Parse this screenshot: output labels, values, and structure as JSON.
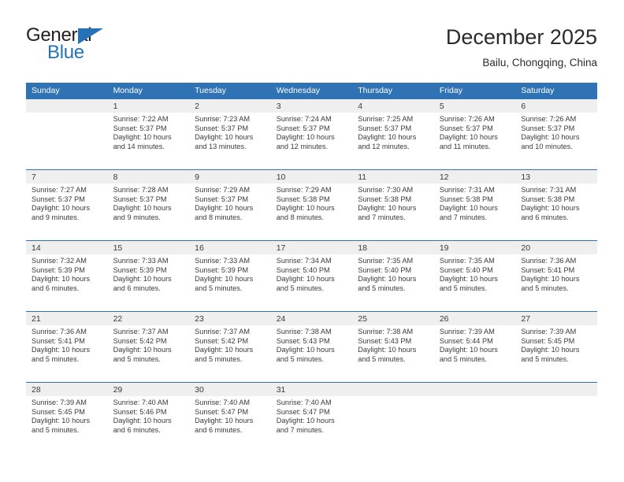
{
  "brand": {
    "name_top": "General",
    "name_bottom": "Blue",
    "triangle_color": "#2572b8",
    "text_color": "#231f20"
  },
  "header": {
    "title": "December 2025",
    "subtitle": "Bailu, Chongqing, China"
  },
  "theme": {
    "header_blue": "#3073b4",
    "daynum_bg": "#efefef",
    "text": "#3a3a3a"
  },
  "weekdays": [
    "Sunday",
    "Monday",
    "Tuesday",
    "Wednesday",
    "Thursday",
    "Friday",
    "Saturday"
  ],
  "weeks": [
    [
      {
        "day": "",
        "sunrise": "",
        "sunset": "",
        "daylight1": "",
        "daylight2": ""
      },
      {
        "day": "1",
        "sunrise": "Sunrise: 7:22 AM",
        "sunset": "Sunset: 5:37 PM",
        "daylight1": "Daylight: 10 hours",
        "daylight2": "and 14 minutes."
      },
      {
        "day": "2",
        "sunrise": "Sunrise: 7:23 AM",
        "sunset": "Sunset: 5:37 PM",
        "daylight1": "Daylight: 10 hours",
        "daylight2": "and 13 minutes."
      },
      {
        "day": "3",
        "sunrise": "Sunrise: 7:24 AM",
        "sunset": "Sunset: 5:37 PM",
        "daylight1": "Daylight: 10 hours",
        "daylight2": "and 12 minutes."
      },
      {
        "day": "4",
        "sunrise": "Sunrise: 7:25 AM",
        "sunset": "Sunset: 5:37 PM",
        "daylight1": "Daylight: 10 hours",
        "daylight2": "and 12 minutes."
      },
      {
        "day": "5",
        "sunrise": "Sunrise: 7:26 AM",
        "sunset": "Sunset: 5:37 PM",
        "daylight1": "Daylight: 10 hours",
        "daylight2": "and 11 minutes."
      },
      {
        "day": "6",
        "sunrise": "Sunrise: 7:26 AM",
        "sunset": "Sunset: 5:37 PM",
        "daylight1": "Daylight: 10 hours",
        "daylight2": "and 10 minutes."
      }
    ],
    [
      {
        "day": "7",
        "sunrise": "Sunrise: 7:27 AM",
        "sunset": "Sunset: 5:37 PM",
        "daylight1": "Daylight: 10 hours",
        "daylight2": "and 9 minutes."
      },
      {
        "day": "8",
        "sunrise": "Sunrise: 7:28 AM",
        "sunset": "Sunset: 5:37 PM",
        "daylight1": "Daylight: 10 hours",
        "daylight2": "and 9 minutes."
      },
      {
        "day": "9",
        "sunrise": "Sunrise: 7:29 AM",
        "sunset": "Sunset: 5:37 PM",
        "daylight1": "Daylight: 10 hours",
        "daylight2": "and 8 minutes."
      },
      {
        "day": "10",
        "sunrise": "Sunrise: 7:29 AM",
        "sunset": "Sunset: 5:38 PM",
        "daylight1": "Daylight: 10 hours",
        "daylight2": "and 8 minutes."
      },
      {
        "day": "11",
        "sunrise": "Sunrise: 7:30 AM",
        "sunset": "Sunset: 5:38 PM",
        "daylight1": "Daylight: 10 hours",
        "daylight2": "and 7 minutes."
      },
      {
        "day": "12",
        "sunrise": "Sunrise: 7:31 AM",
        "sunset": "Sunset: 5:38 PM",
        "daylight1": "Daylight: 10 hours",
        "daylight2": "and 7 minutes."
      },
      {
        "day": "13",
        "sunrise": "Sunrise: 7:31 AM",
        "sunset": "Sunset: 5:38 PM",
        "daylight1": "Daylight: 10 hours",
        "daylight2": "and 6 minutes."
      }
    ],
    [
      {
        "day": "14",
        "sunrise": "Sunrise: 7:32 AM",
        "sunset": "Sunset: 5:39 PM",
        "daylight1": "Daylight: 10 hours",
        "daylight2": "and 6 minutes."
      },
      {
        "day": "15",
        "sunrise": "Sunrise: 7:33 AM",
        "sunset": "Sunset: 5:39 PM",
        "daylight1": "Daylight: 10 hours",
        "daylight2": "and 6 minutes."
      },
      {
        "day": "16",
        "sunrise": "Sunrise: 7:33 AM",
        "sunset": "Sunset: 5:39 PM",
        "daylight1": "Daylight: 10 hours",
        "daylight2": "and 5 minutes."
      },
      {
        "day": "17",
        "sunrise": "Sunrise: 7:34 AM",
        "sunset": "Sunset: 5:40 PM",
        "daylight1": "Daylight: 10 hours",
        "daylight2": "and 5 minutes."
      },
      {
        "day": "18",
        "sunrise": "Sunrise: 7:35 AM",
        "sunset": "Sunset: 5:40 PM",
        "daylight1": "Daylight: 10 hours",
        "daylight2": "and 5 minutes."
      },
      {
        "day": "19",
        "sunrise": "Sunrise: 7:35 AM",
        "sunset": "Sunset: 5:40 PM",
        "daylight1": "Daylight: 10 hours",
        "daylight2": "and 5 minutes."
      },
      {
        "day": "20",
        "sunrise": "Sunrise: 7:36 AM",
        "sunset": "Sunset: 5:41 PM",
        "daylight1": "Daylight: 10 hours",
        "daylight2": "and 5 minutes."
      }
    ],
    [
      {
        "day": "21",
        "sunrise": "Sunrise: 7:36 AM",
        "sunset": "Sunset: 5:41 PM",
        "daylight1": "Daylight: 10 hours",
        "daylight2": "and 5 minutes."
      },
      {
        "day": "22",
        "sunrise": "Sunrise: 7:37 AM",
        "sunset": "Sunset: 5:42 PM",
        "daylight1": "Daylight: 10 hours",
        "daylight2": "and 5 minutes."
      },
      {
        "day": "23",
        "sunrise": "Sunrise: 7:37 AM",
        "sunset": "Sunset: 5:42 PM",
        "daylight1": "Daylight: 10 hours",
        "daylight2": "and 5 minutes."
      },
      {
        "day": "24",
        "sunrise": "Sunrise: 7:38 AM",
        "sunset": "Sunset: 5:43 PM",
        "daylight1": "Daylight: 10 hours",
        "daylight2": "and 5 minutes."
      },
      {
        "day": "25",
        "sunrise": "Sunrise: 7:38 AM",
        "sunset": "Sunset: 5:43 PM",
        "daylight1": "Daylight: 10 hours",
        "daylight2": "and 5 minutes."
      },
      {
        "day": "26",
        "sunrise": "Sunrise: 7:39 AM",
        "sunset": "Sunset: 5:44 PM",
        "daylight1": "Daylight: 10 hours",
        "daylight2": "and 5 minutes."
      },
      {
        "day": "27",
        "sunrise": "Sunrise: 7:39 AM",
        "sunset": "Sunset: 5:45 PM",
        "daylight1": "Daylight: 10 hours",
        "daylight2": "and 5 minutes."
      }
    ],
    [
      {
        "day": "28",
        "sunrise": "Sunrise: 7:39 AM",
        "sunset": "Sunset: 5:45 PM",
        "daylight1": "Daylight: 10 hours",
        "daylight2": "and 5 minutes."
      },
      {
        "day": "29",
        "sunrise": "Sunrise: 7:40 AM",
        "sunset": "Sunset: 5:46 PM",
        "daylight1": "Daylight: 10 hours",
        "daylight2": "and 6 minutes."
      },
      {
        "day": "30",
        "sunrise": "Sunrise: 7:40 AM",
        "sunset": "Sunset: 5:47 PM",
        "daylight1": "Daylight: 10 hours",
        "daylight2": "and 6 minutes."
      },
      {
        "day": "31",
        "sunrise": "Sunrise: 7:40 AM",
        "sunset": "Sunset: 5:47 PM",
        "daylight1": "Daylight: 10 hours",
        "daylight2": "and 7 minutes."
      },
      {
        "day": "",
        "sunrise": "",
        "sunset": "",
        "daylight1": "",
        "daylight2": ""
      },
      {
        "day": "",
        "sunrise": "",
        "sunset": "",
        "daylight1": "",
        "daylight2": ""
      },
      {
        "day": "",
        "sunrise": "",
        "sunset": "",
        "daylight1": "",
        "daylight2": ""
      }
    ]
  ]
}
